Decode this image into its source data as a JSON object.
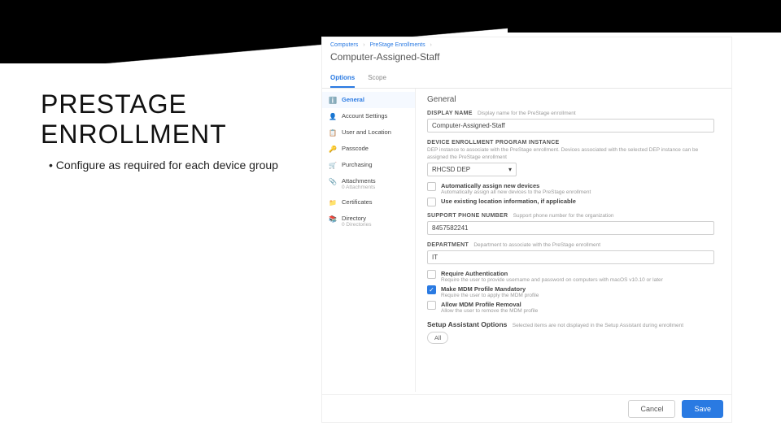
{
  "slide": {
    "title_l1": "PRESTAGE",
    "title_l2": "ENROLLMENT",
    "bullet": "Configure as required for each device group"
  },
  "app": {
    "breadcrumbs": [
      "Computers",
      "PreStage Enrollments"
    ],
    "pageTitle": "Computer-Assigned-Staff",
    "tabs": {
      "options": "Options",
      "scope": "Scope"
    },
    "sidenav": [
      {
        "label": "General",
        "icon": "ℹ️",
        "active": true
      },
      {
        "label": "Account Settings",
        "icon": "👤"
      },
      {
        "label": "User and Location",
        "icon": "📋"
      },
      {
        "label": "Passcode",
        "icon": "🔑"
      },
      {
        "label": "Purchasing",
        "icon": "🛒"
      },
      {
        "label": "Attachments",
        "sub": "0 Attachments",
        "icon": "📎"
      },
      {
        "label": "Certificates",
        "icon": "📁"
      },
      {
        "label": "Directory",
        "sub": "0 Directories",
        "icon": "📚"
      }
    ],
    "general": {
      "heading": "General",
      "displayName": {
        "label": "DISPLAY NAME",
        "help": "Display name for the PreStage enrollment",
        "value": "Computer-Assigned-Staff"
      },
      "depInstance": {
        "label": "DEVICE ENROLLMENT PROGRAM INSTANCE",
        "help": "DEP instance to associate with the PreStage enrollment. Devices associated with the selected DEP instance can be assigned the PreStage enrollment",
        "value": "RHCSD DEP"
      },
      "autoAssign": {
        "label": "Automatically assign new devices",
        "help": "Automatically assign all new devices to the PreStage enrollment",
        "checked": false
      },
      "useLocation": {
        "label": "Use existing location information, if applicable",
        "checked": false
      },
      "phone": {
        "label": "SUPPORT PHONE NUMBER",
        "help": "Support phone number for the organization",
        "value": "8457582241"
      },
      "department": {
        "label": "DEPARTMENT",
        "help": "Department to associate with the PreStage enrollment",
        "value": "IT"
      },
      "requireAuth": {
        "label": "Require Authentication",
        "help": "Require the user to provide username and password on computers with macOS v10.10 or later",
        "checked": false
      },
      "mdmMandatory": {
        "label": "Make MDM Profile Mandatory",
        "help": "Require the user to apply the MDM profile",
        "checked": true
      },
      "mdmRemoval": {
        "label": "Allow MDM Profile Removal",
        "help": "Allow the user to remove the MDM profile",
        "checked": false
      },
      "setupAssist": {
        "heading": "Setup Assistant Options",
        "help": "Selected items are not displayed in the Setup Assistant during enrollment",
        "pill": "All"
      }
    },
    "footer": {
      "hint": "",
      "cancel": "Cancel",
      "save": "Save"
    }
  }
}
